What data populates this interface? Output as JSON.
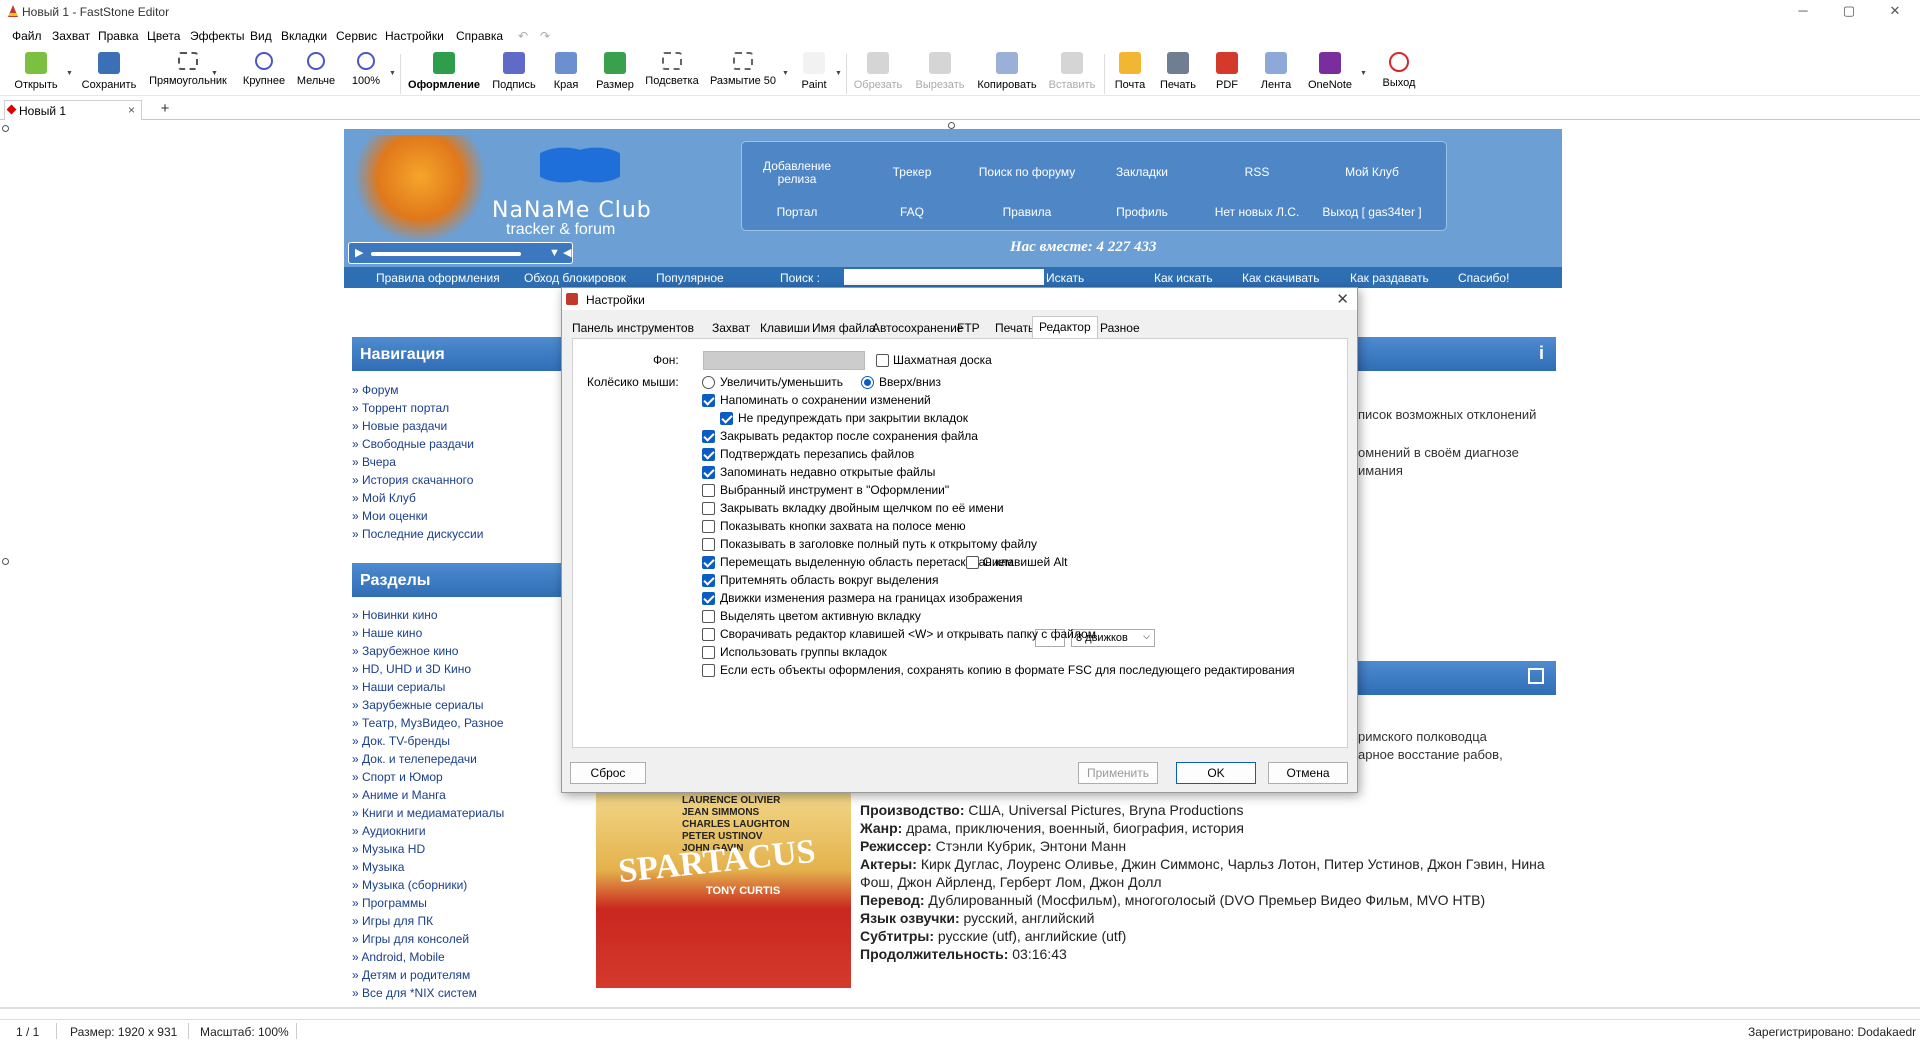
{
  "window": {
    "title": "Новый 1 - FastStone Editor",
    "minimize": "─",
    "maximize": "▢",
    "close": "✕"
  },
  "menu": [
    "Файл",
    "Захват",
    "Правка",
    "Цвета",
    "Эффекты",
    "Вид",
    "Вкладки",
    "Сервис",
    "Настройки",
    "Справка"
  ],
  "toolbar": {
    "open": "Открыть",
    "save": "Сохранить",
    "rect": "Прямоугольник",
    "zoomin": "Крупнее",
    "zoomout": "Мельче",
    "zoom": "100%",
    "draw": "Оформление",
    "caption": "Подпись",
    "edge": "Края",
    "resize": "Размер",
    "highlight": "Подсветка",
    "blur": "Размытие 50",
    "paint": "Paint",
    "crop": "Обрезать",
    "cut": "Вырезать",
    "copy": "Копировать",
    "paste": "Вставить",
    "mail": "Почта",
    "print": "Печать",
    "pdf": "PDF",
    "ribbon": "Лента",
    "onenote": "OneNote",
    "exit": "Выход"
  },
  "tab": {
    "label": "Новый 1",
    "close": "×",
    "new": "+"
  },
  "site": {
    "logo1": "NaNaMe Club",
    "logo2": "tracker & forum",
    "menu": [
      "Добавление релиза",
      "Трекер",
      "Поиск по форуму",
      "Закладки",
      "RSS",
      "Мой Клуб",
      "Портал",
      "FAQ",
      "Правила",
      "Профиль",
      "Нет новых Л.С.",
      "Выход [ gas34ter ]"
    ],
    "together": "Нас вместе: 4 227 433",
    "nav": [
      "Правила оформления",
      "Обход блокировок",
      "Популярное",
      "Поиск :",
      "Искать",
      "Как искать",
      "Как скачивать",
      "Как раздавать",
      "Спасибо!"
    ],
    "nav_title": "Навигация",
    "nav_items": [
      "» Форум",
      "» Торрент портал",
      "» Новые раздачи",
      "» Свободные раздачи",
      "» Вчера",
      "» История скачанного",
      "» Мой Клуб",
      "» Мои оценки",
      "» Последние дискуссии"
    ],
    "sections_title": "Разделы",
    "section_items": [
      "» Новинки кино",
      "» Наше кино",
      "» Зарубежное кино",
      "» HD, UHD и 3D Кино",
      "» Наши сериалы",
      "» Зарубежные сериалы",
      "» Театр, МузВидео, Разное",
      "» Док. TV-бренды",
      "» Док. и телепередачи",
      "» Спорт и Юмор",
      "» Аниме и Манга",
      "» Книги и медиаматериалы",
      "» Аудиокниги",
      "» Музыка HD",
      "» Музыка",
      "» Музыка (сборники)",
      "» Программы",
      "» Игры для ПК",
      "» Игры для консолей",
      "» Android, Mobile",
      "» Детям и родителям",
      "» Все для *NIX систем"
    ],
    "right_texts": [
      "писок возможных отклонений",
      "омнений в своём диагнозе",
      "имания",
      "римского полководца",
      "арное восстание рабов,"
    ],
    "poster": {
      "names": [
        "LAURENCE OLIVIER",
        "JEAN SIMMONS",
        "CHARLES LAUGHTON",
        "PETER USTINOV",
        "JOHN GAVIN"
      ],
      "title": "SPARTACUS",
      "star": "TONY CURTIS"
    },
    "info": [
      {
        "k": "Производство:",
        "v": " США, Universal Pictures, Bryna Productions"
      },
      {
        "k": "Жанр:",
        "v": " драма, приключения, военный, биография, история"
      },
      {
        "k": "Режиссер:",
        "v": " Стэнли Кубрик, Энтони Манн"
      },
      {
        "k": "Актеры:",
        "v": " Кирк Дуглас, Лоуренс Оливье, Джин Симмонс, Чарльз Лотон, Питер Устинов, Джон Гэвин, Нина Фош, Джон Айрленд, Герберт Лом, Джон Долл"
      },
      {
        "k": "Перевод:",
        "v": " Дублированный (Мосфильм), многоголосый (DVO Премьер Видео Фильм, MVO НТВ)"
      },
      {
        "k": "Язык озвучки:",
        "v": " русский, английский"
      },
      {
        "k": "Субтитры:",
        "v": " русские (utf), английские (utf)"
      },
      {
        "k": "Продолжительность:",
        "v": " 03:16:43"
      }
    ]
  },
  "dialog": {
    "title": "Настройки",
    "close": "✕",
    "tabs": [
      "Панель инструментов",
      "Захват",
      "Клавиши",
      "Имя файла",
      "Автосохранение",
      "FTP",
      "Печать",
      "Редактор",
      "Разное"
    ],
    "bg_label": "Фон:",
    "checker": "Шахматная доска",
    "wheel_label": "Колёсико мыши:",
    "wheel_zoom": "Увеличить/уменьшить",
    "wheel_scroll": "Вверх/вниз",
    "options": [
      {
        "label": "Напоминать о сохранении изменений",
        "checked": true
      },
      {
        "label": "Не предупреждать при закрытии вкладок",
        "checked": true
      },
      {
        "label": "Закрывать редактор после сохранения файла",
        "checked": true
      },
      {
        "label": "Подтверждать перезапись файлов",
        "checked": true
      },
      {
        "label": "Запоминать недавно открытые файлы",
        "checked": true
      },
      {
        "label": "Выбранный инструмент в \"Оформлении\"",
        "checked": false
      },
      {
        "label": "Закрывать вкладку двойным щелчком по её имени",
        "checked": false
      },
      {
        "label": "Показывать кнопки захвата на полосе меню",
        "checked": false
      },
      {
        "label": "Показывать в заголовке полный путь к открытому файлу",
        "checked": false
      },
      {
        "label": "Перемещать выделенную область перетаскиванием",
        "checked": true
      },
      {
        "label": "Притемнять область вокруг выделения",
        "checked": true
      },
      {
        "label": "Движки изменения размера на границах изображения",
        "checked": true
      },
      {
        "label": "Выделять цветом активную вкладку",
        "checked": false
      },
      {
        "label": "Сворачивать редактор клавишей <W> и открывать папку с файлом",
        "checked": false
      },
      {
        "label": "Использовать группы вкладок",
        "checked": false
      },
      {
        "label": "Если есть объекты оформления, сохранять копию в формате FSC для последующего редактирования",
        "checked": false
      }
    ],
    "alt_label": "С клавишей Alt",
    "handles_select": "8 движков",
    "reset": "Сброс",
    "apply": "Применить",
    "ok": "OK",
    "cancel": "Отмена"
  },
  "status": {
    "page": "1 / 1",
    "size": "Размер: 1920 x 931",
    "scale": "Масштаб: 100%",
    "reg": "Зарегистрировано: Dodakaedr"
  }
}
